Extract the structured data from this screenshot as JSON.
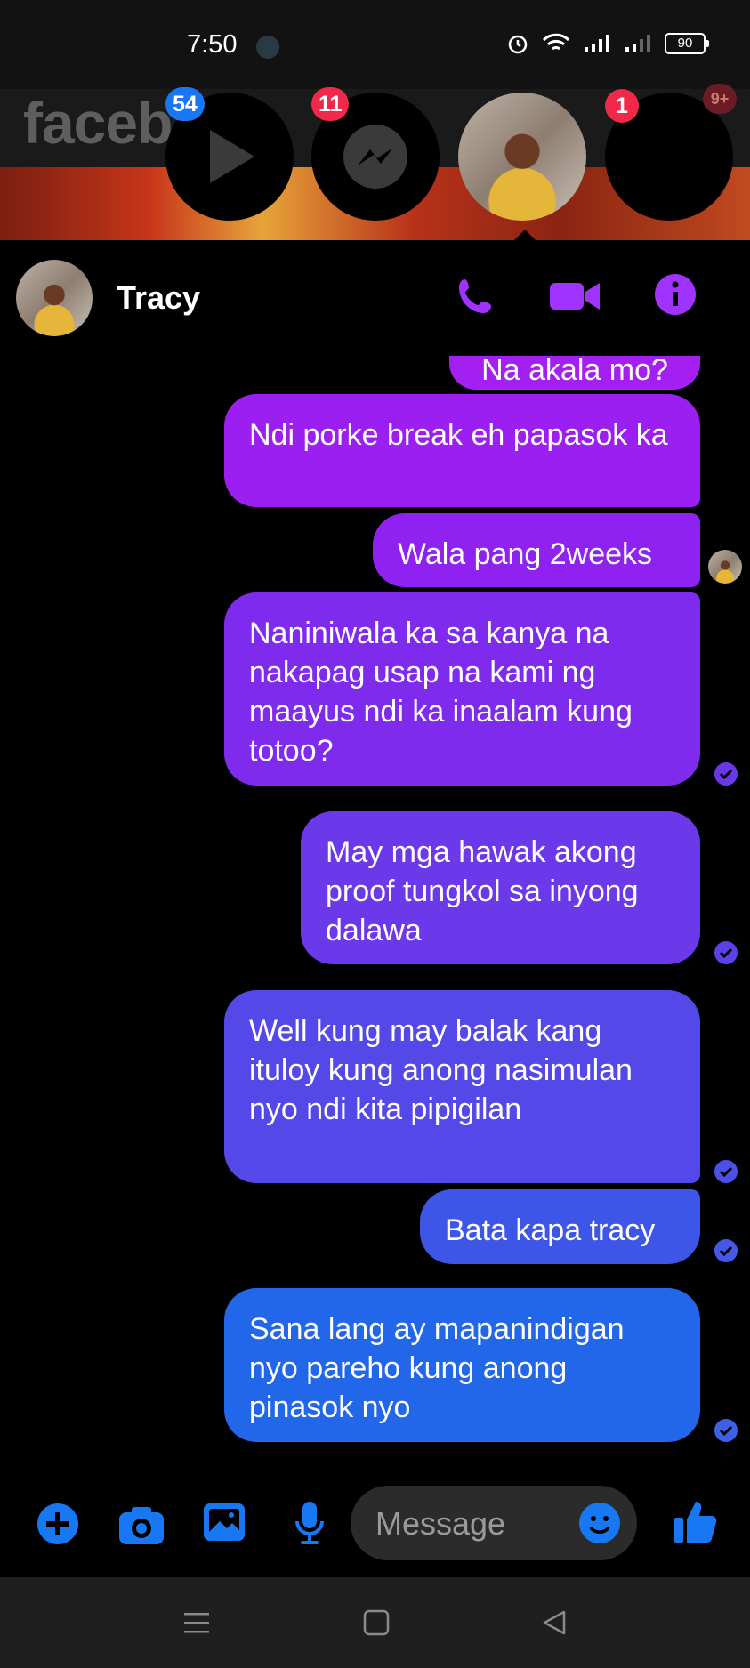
{
  "status_bar": {
    "time": "7:50",
    "battery": "90"
  },
  "background": {
    "logo_text": "faceb"
  },
  "chat_heads": [
    {
      "name": "video-head",
      "badge": "54",
      "badge_color": "#1877f2"
    },
    {
      "name": "messenger-head",
      "badge": "11",
      "badge_color": "#f02849"
    },
    {
      "name": "tracy-head",
      "badge": ""
    },
    {
      "name": "other-head",
      "badge": "1",
      "badge_color": "#f02849"
    }
  ],
  "overflow_badge": "9+",
  "header": {
    "name": "Tracy"
  },
  "messages": [
    {
      "text": "Na akala mo?"
    },
    {
      "text": "Ndi porke break eh papasok ka"
    },
    {
      "text": "Wala pang 2weeks"
    },
    {
      "text": "Naniniwala ka sa kanya na nakapag usap na kami ng maayus ndi ka inaalam kung totoo?"
    },
    {
      "text": "May mga hawak akong proof tungkol sa inyong dalawa"
    },
    {
      "text": "Well kung may balak kang ituloy kung anong nasimulan nyo ndi kita pipigilan"
    },
    {
      "text": "Bata kapa tracy"
    },
    {
      "text": "Sana lang ay mapanindigan nyo pareho kung anong pinasok nyo"
    }
  ],
  "composer": {
    "placeholder": "Message"
  },
  "colors": {
    "accent": "#a033ff",
    "blue": "#1877f2",
    "bubble_top": "#9b1ff0",
    "bubble_bottom": "#1f6fea"
  }
}
